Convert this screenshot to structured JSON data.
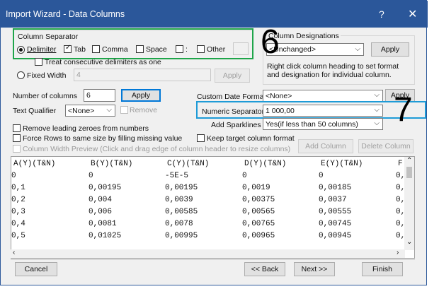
{
  "window": {
    "title": "Import Wizard - Data Columns",
    "help": "?",
    "close": "✕"
  },
  "separator": {
    "group_title": "Column Separator",
    "delimiter_label": "Delimiter",
    "tab_label": "Tab",
    "comma_label": "Comma",
    "space_label": "Space",
    "colon_label": ":",
    "other_label": "Other",
    "treat_consecutive_label": "Treat consecutive delimiters as one",
    "fixed_width_label": "Fixed Width",
    "fixed_width_value": "4",
    "apply_label": "Apply"
  },
  "designations": {
    "group_title": "Column Designations",
    "value": "<Unchanged>",
    "apply_label": "Apply",
    "hint": "Right click column heading to set format and designation for individual column."
  },
  "number_of_columns": {
    "label": "Number of columns",
    "value": "6",
    "apply_label": "Apply"
  },
  "text_qualifier": {
    "label": "Text Qualifier",
    "value": "<None>",
    "remove_label": "Remove"
  },
  "custom_date": {
    "label": "Custom Date Format",
    "value": "<None>",
    "apply_label": "Apply"
  },
  "numeric_separator": {
    "label": "Numeric Separator",
    "value": "1 000,00"
  },
  "sparklines": {
    "label": "Add Sparklines",
    "value": "Yes(if less than 50 columns)"
  },
  "options": {
    "remove_zeros": "Remove leading zeroes from numbers",
    "force_rows": "Force Rows to same size by filling missing value",
    "keep_format": "Keep target column format",
    "column_width_preview": "Column Width Preview (Click and drag edge of column header to resize columns)"
  },
  "column_buttons": {
    "add": "Add Column",
    "delete": "Delete Column"
  },
  "preview": {
    "headers": [
      "A(Y)(T&N)",
      "B(Y)(T&N)",
      "C(Y)(T&N)",
      "D(Y)(T&N)",
      "E(Y)(T&N)",
      "F"
    ],
    "rows": [
      [
        "0",
        "0",
        "-5E-5",
        "0",
        "0",
        "0,"
      ],
      [
        "0,1",
        "0,00195",
        "0,00195",
        "0,0019",
        "0,00185",
        "0,"
      ],
      [
        "0,2",
        "0,004",
        "0,0039",
        "0,00375",
        "0,0037",
        "0,"
      ],
      [
        "0,3",
        "0,006",
        "0,00585",
        "0,00565",
        "0,00555",
        "0,"
      ],
      [
        "0,4",
        "0,0081",
        "0,0078",
        "0,00765",
        "0,00745",
        "0,"
      ],
      [
        "0,5",
        "0,01025",
        "0,00995",
        "0,00965",
        "0,00945",
        "0,"
      ]
    ]
  },
  "footer": {
    "cancel": "Cancel",
    "back": "<< Back",
    "next": "Next >>",
    "finish": "Finish"
  },
  "annotations": {
    "six": "6",
    "seven": "7"
  },
  "colors": {
    "titlebar": "#2b579a",
    "highlight_green": "#1fa54a",
    "highlight_blue": "#1e9bd7"
  }
}
